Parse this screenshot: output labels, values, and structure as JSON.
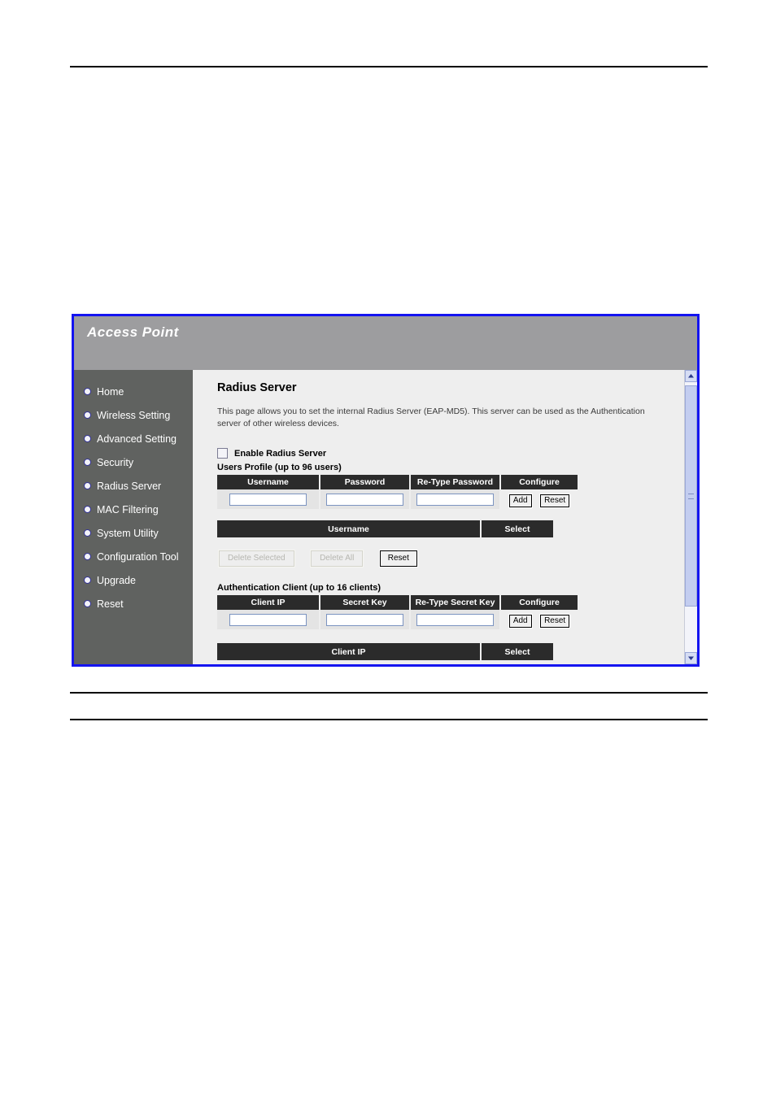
{
  "page": {
    "rules": [
      "top",
      "middle",
      "bottom"
    ]
  },
  "device": {
    "brand_title": "Access Point",
    "sidebar": {
      "items": [
        {
          "label": "Home",
          "name": "home"
        },
        {
          "label": "Wireless Setting",
          "name": "wireless-setting"
        },
        {
          "label": "Advanced Setting",
          "name": "advanced-setting"
        },
        {
          "label": "Security",
          "name": "security"
        },
        {
          "label": "Radius Server",
          "name": "radius-server"
        },
        {
          "label": "MAC Filtering",
          "name": "mac-filtering"
        },
        {
          "label": "System Utility",
          "name": "system-utility"
        },
        {
          "label": "Configuration Tool",
          "name": "configuration-tool"
        },
        {
          "label": "Upgrade",
          "name": "upgrade"
        },
        {
          "label": "Reset",
          "name": "reset"
        }
      ]
    },
    "content": {
      "title": "Radius Server",
      "description": "This page allows you to set the internal Radius Server (EAP-MD5). This server can be used as the Authentication server of other wireless devices.",
      "enable_checkbox_label": "Enable Radius Server",
      "enable_checkbox_checked": false,
      "users_profile": {
        "section_label": "Users Profile (up to 96 users)",
        "columns": [
          "Username",
          "Password",
          "Re-Type Password",
          "Configure"
        ],
        "input_values": {
          "username": "",
          "password": "",
          "retype_password": ""
        },
        "add_label": "Add",
        "reset_label": "Reset",
        "list_columns": [
          "Username",
          "Select"
        ],
        "actions": {
          "delete_selected": "Delete Selected",
          "delete_all": "Delete All",
          "reset": "Reset",
          "delete_selected_enabled": false,
          "delete_all_enabled": false,
          "reset_enabled": true
        }
      },
      "authentication_client": {
        "section_label": "Authentication Client (up to 16 clients)",
        "columns": [
          "Client IP",
          "Secret Key",
          "Re-Type Secret Key",
          "Configure"
        ],
        "input_values": {
          "client_ip": "",
          "secret_key": "",
          "retype_secret_key": ""
        },
        "add_label": "Add",
        "reset_label": "Reset",
        "list_columns": [
          "Client IP",
          "Select"
        ]
      }
    },
    "scrollbar": {
      "up_icon": "chevron-up-icon",
      "down_icon": "chevron-down-icon",
      "thumb_position_percent": 2
    },
    "colors": {
      "panel_border": "#1414f0",
      "brand_header": "#9d9d9f",
      "sidebar": "#606260",
      "content_bg": "#eeeeee",
      "table_header": "#2b2b2b",
      "scroll_thumb": "#c3cdf0"
    }
  }
}
